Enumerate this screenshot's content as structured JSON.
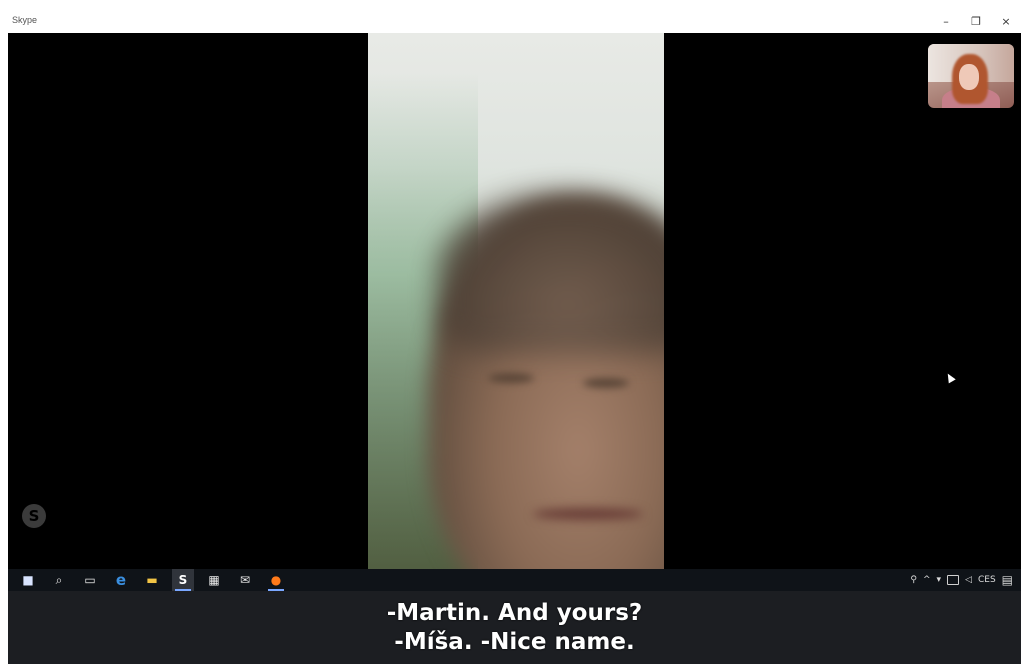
{
  "window": {
    "title": "Skype",
    "controls": {
      "minimize": "–",
      "maximize": "❐",
      "close": "×"
    }
  },
  "video": {
    "remote_participant": "video-feed",
    "self_view": "self-view-thumbnail",
    "watermark_icon": "skype-logo-icon",
    "watermark_glyph": "S"
  },
  "taskbar": {
    "icons": [
      {
        "name": "windows-start-icon",
        "glyph": "■"
      },
      {
        "name": "search-icon",
        "glyph": "⌕"
      },
      {
        "name": "task-view-icon",
        "glyph": "▭"
      },
      {
        "name": "edge-browser-icon",
        "glyph": "e"
      },
      {
        "name": "file-explorer-icon",
        "glyph": "▬"
      },
      {
        "name": "skype-app-icon",
        "glyph": "S"
      },
      {
        "name": "store-icon",
        "glyph": "▦"
      },
      {
        "name": "mail-icon",
        "glyph": "✉"
      },
      {
        "name": "firefox-icon",
        "glyph": "●"
      }
    ],
    "tray": {
      "people_icon": "⚲",
      "chevron": "^",
      "network": "▾",
      "volume": "◁",
      "language": "CES",
      "notifications": "▤"
    }
  },
  "subtitles": {
    "line1": "-Martin. And yours?",
    "line2": "-Míša. -Nice name."
  },
  "colors": {
    "taskbar_bg": "#0f1318",
    "subtitle_bg": "#1c1e22",
    "subtitle_text": "#ffffff",
    "accent": "#7aa7ff"
  }
}
